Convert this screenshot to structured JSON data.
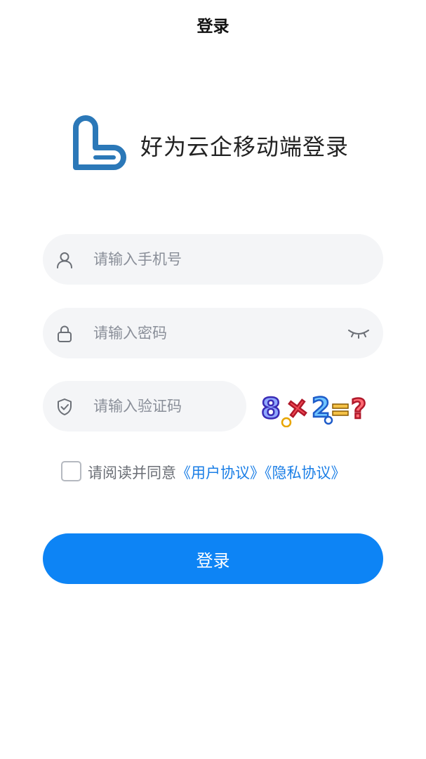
{
  "nav": {
    "title": "登录"
  },
  "brand": {
    "title": "好为云企移动端登录",
    "logo_icon": "brand-logo-icon",
    "logo_color": "#2b78b8"
  },
  "form": {
    "phone": {
      "placeholder": "请输入手机号",
      "value": "",
      "icon": "user-icon"
    },
    "password": {
      "placeholder": "请输入密码",
      "value": "",
      "icon": "lock-icon",
      "toggle_icon": "eye-closed-icon"
    },
    "captcha": {
      "placeholder": "请输入验证码",
      "value": "",
      "icon": "shield-check-icon",
      "image_text": "8×2=?"
    }
  },
  "agreement": {
    "prefix": "请阅读并同意",
    "user_agreement": "《用户协议》",
    "privacy_agreement": "《隐私协议》",
    "checked": false
  },
  "login_button": {
    "label": "登录"
  },
  "colors": {
    "primary": "#0d84f5",
    "link": "#1a7ee6",
    "field_bg": "#f4f5f7"
  }
}
